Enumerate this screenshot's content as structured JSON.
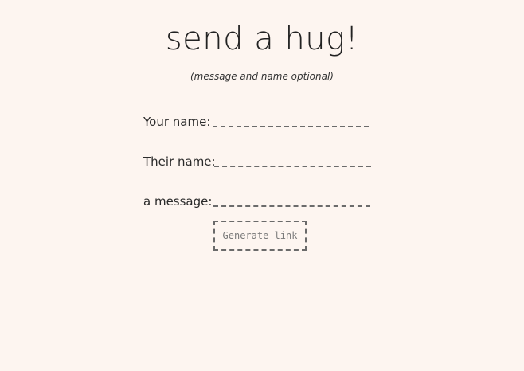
{
  "header": {
    "title": "send a hug!",
    "subtitle": "(message and name optional)"
  },
  "form": {
    "your_name": {
      "label": "Your name:",
      "value": ""
    },
    "their_name": {
      "label": "Their name:",
      "value": ""
    },
    "message": {
      "label": "a message:",
      "value": ""
    },
    "generate_label": "Generate link"
  }
}
